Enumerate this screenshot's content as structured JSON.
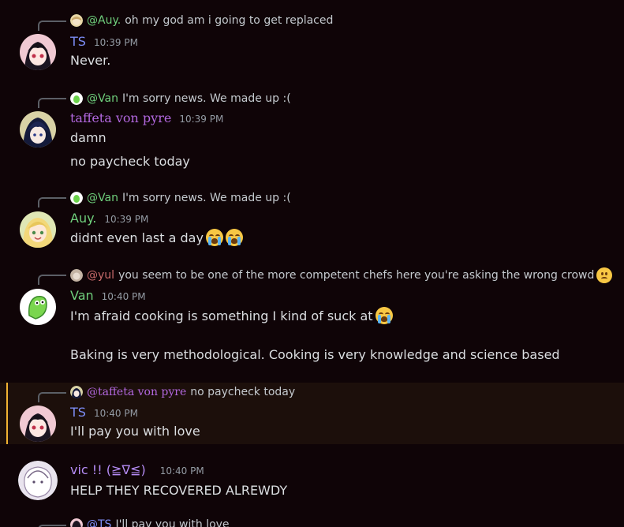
{
  "colors": {
    "ts": "#7c8cf5",
    "taffeta": "#b368e0",
    "auy": "#6fcf7c",
    "van": "#6fcf7c",
    "yul": "#c76a6a",
    "vic": "#b58cf5"
  },
  "messages": [
    {
      "reply": {
        "name": "@Auy.",
        "text": "oh my god am i going to get replaced"
      },
      "user": "TS",
      "time": "10:39 PM",
      "lines": [
        "Never."
      ]
    },
    {
      "reply": {
        "name": "@Van",
        "text": "I'm sorry news. We made up :("
      },
      "user": "taffeta von pyre",
      "time": "10:39 PM",
      "lines": [
        "damn",
        "no paycheck today"
      ]
    },
    {
      "reply": {
        "name": "@Van",
        "text": "I'm sorry news. We made up :("
      },
      "user": "Auy.",
      "time": "10:39 PM",
      "lines": [
        "didnt even last a day"
      ]
    },
    {
      "reply": {
        "name": "@yul",
        "text": "you seem to be one of the more competent chefs here you're asking the wrong crowd"
      },
      "user": "Van",
      "time": "10:40 PM",
      "lines": [
        "I'm afraid cooking is something I kind of suck at",
        "Baking is very methodological. Cooking is very knowledge and science based"
      ]
    },
    {
      "reply": {
        "name": "@taffeta von pyre",
        "text": "no paycheck today"
      },
      "user": "TS",
      "time": "10:40 PM",
      "lines": [
        "I'll pay you with love"
      ]
    },
    {
      "user": "vic !!  (≧∇≦)",
      "time": "10:40 PM",
      "lines": [
        "HELP THEY RECOVERED ALREWDY"
      ]
    },
    {
      "reply": {
        "name": "@TS",
        "text": "I'll pay you with love"
      }
    }
  ]
}
